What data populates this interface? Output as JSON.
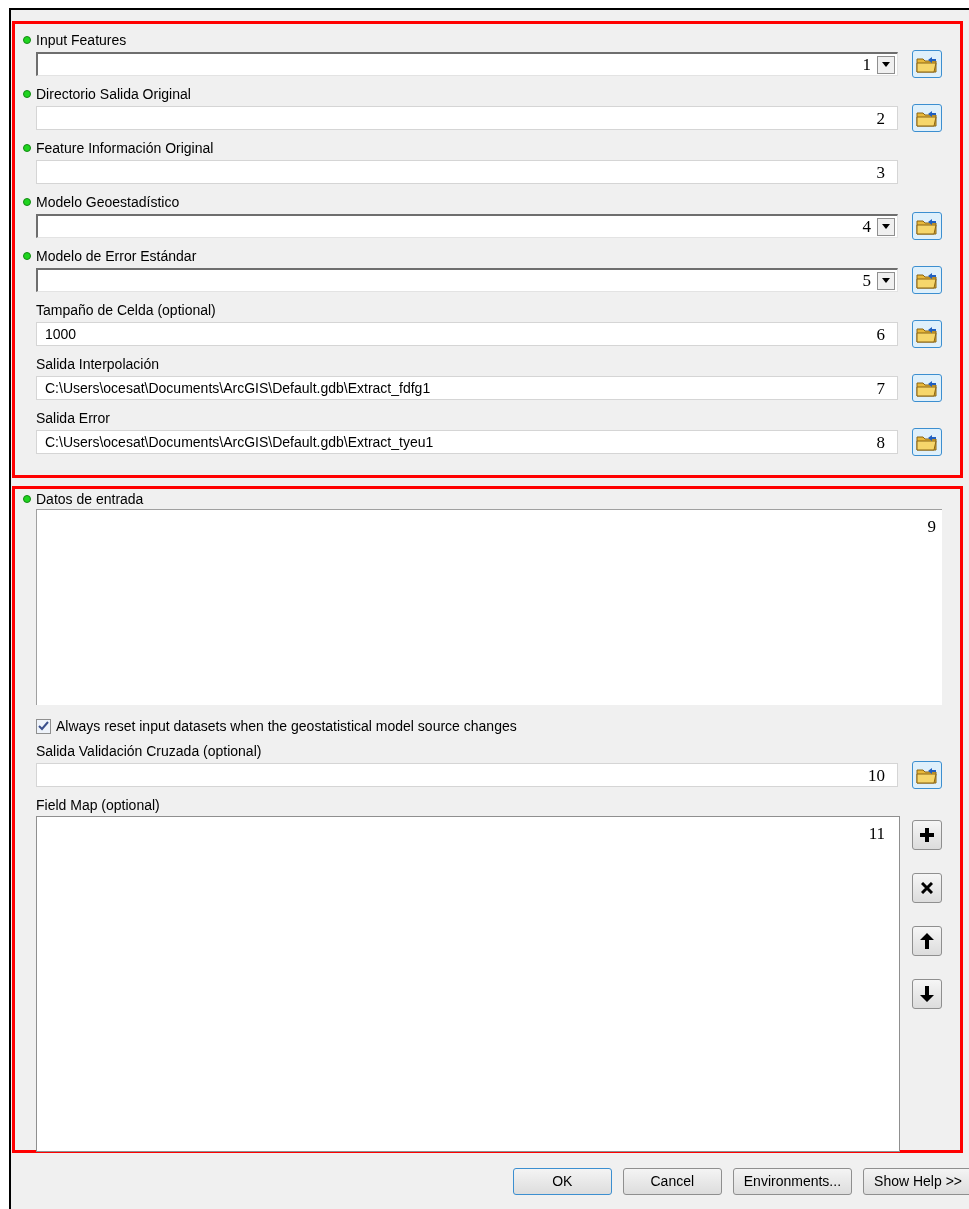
{
  "sections": [
    {
      "params": [
        {
          "kind": "dropdown",
          "label": "Input Features",
          "required": true,
          "marker": "1",
          "browse": true
        },
        {
          "kind": "text",
          "label": "Directorio Salida Original",
          "required": true,
          "marker": "2",
          "browse": true
        },
        {
          "kind": "text",
          "label": "Feature Información Original",
          "required": true,
          "marker": "3",
          "browse": false
        },
        {
          "kind": "dropdown",
          "label": "Modelo Geoestadístico",
          "required": true,
          "marker": "4",
          "browse": true
        },
        {
          "kind": "dropdown",
          "label": "Modelo de Error Estándar",
          "required": true,
          "marker": "5",
          "browse": true
        },
        {
          "kind": "text",
          "label": "Tampaño de Celda (optional)",
          "required": false,
          "value": "1000",
          "marker": "6",
          "browse": true
        },
        {
          "kind": "text",
          "label": "Salida Interpolación",
          "required": false,
          "value": "C:\\Users\\ocesat\\Documents\\ArcGIS\\Default.gdb\\Extract_fdfg1",
          "marker": "7",
          "browse": true
        },
        {
          "kind": "text",
          "label": "Salida Error",
          "required": false,
          "value": "C:\\Users\\ocesat\\Documents\\ArcGIS\\Default.gdb\\Extract_tyeu1",
          "marker": "8",
          "browse": true
        }
      ]
    },
    {
      "params": [
        {
          "kind": "multiline",
          "label": "Datos de entrada",
          "required": true,
          "marker": "9"
        },
        {
          "kind": "checkbox",
          "label": "Always reset input datasets when the geostatistical model source changes",
          "checked": true
        },
        {
          "kind": "text",
          "label": "Salida Validación Cruzada (optional)",
          "required": false,
          "marker": "10",
          "browse": true
        },
        {
          "kind": "list",
          "label": "Field Map (optional)",
          "required": false,
          "marker": "11",
          "tools": [
            {
              "kind": "add"
            },
            {
              "kind": "remove"
            },
            {
              "kind": "up"
            },
            {
              "kind": "down"
            }
          ]
        }
      ]
    }
  ],
  "buttons": [
    "OK",
    "Cancel",
    "Environments...",
    "Show Help >>"
  ]
}
